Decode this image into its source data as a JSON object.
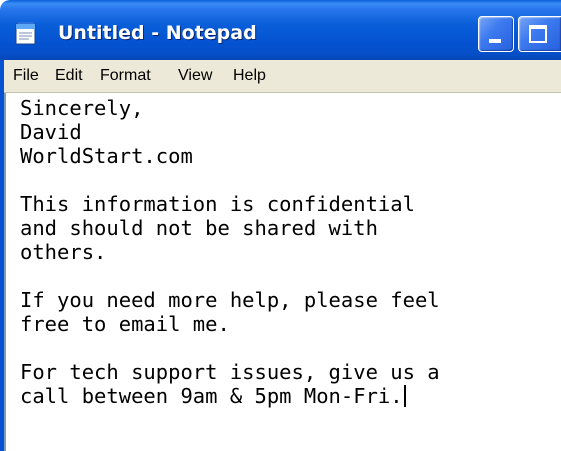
{
  "window": {
    "title": "Untitled - Notepad",
    "accent_color": "#0a5fd8",
    "title_text_color": "#ffffff",
    "app_icon": "notepad-icon"
  },
  "titlebar_buttons": {
    "minimize_icon": "minimize-icon",
    "maximize_icon": "maximize-icon"
  },
  "menu": {
    "items": [
      {
        "label": "File"
      },
      {
        "label": "Edit"
      },
      {
        "label": "Format"
      },
      {
        "label": "View"
      },
      {
        "label": "Help"
      }
    ]
  },
  "document": {
    "lines": [
      "Sincerely,",
      "David",
      "WorldStart.com",
      "",
      "This information is confidential",
      "and should not be shared with",
      "others.",
      "",
      "If you need more help, please feel",
      "free to email me.",
      "",
      "For tech support issues, give us a",
      "call between 9am & 5pm Mon-Fri."
    ]
  }
}
